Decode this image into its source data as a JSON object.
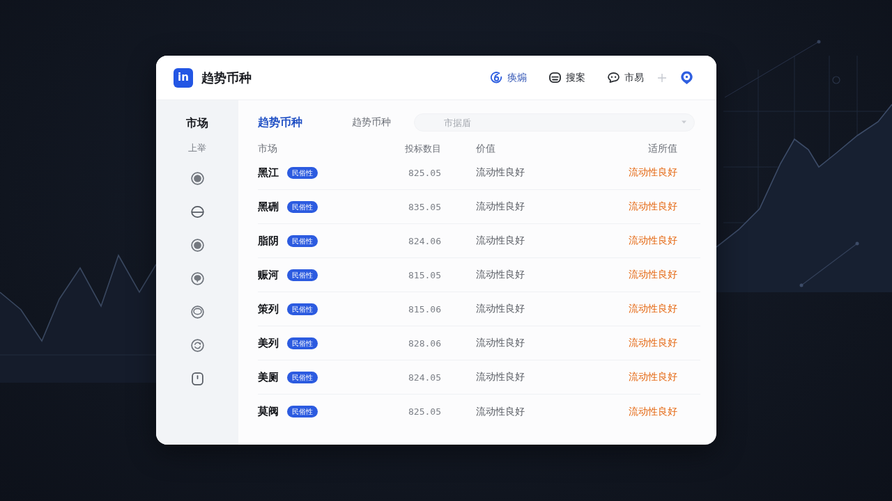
{
  "header": {
    "logo_text": "in",
    "title": "趋势币种",
    "nav": [
      {
        "label": "痪煽",
        "selected": true
      },
      {
        "label": "搜案",
        "selected": false
      },
      {
        "label": "市易",
        "selected": false
      }
    ]
  },
  "sidebar": {
    "items": [
      {
        "label": "市场",
        "selected": true
      },
      {
        "label": "上举",
        "selected": false
      }
    ]
  },
  "tabs": [
    {
      "label": "趋势币种",
      "selected": true
    },
    {
      "label": "趋势币种",
      "selected": false
    }
  ],
  "search": {
    "placeholder": "市据盾"
  },
  "table": {
    "columns": [
      "市场",
      "投标数目",
      "价值",
      "适所值"
    ],
    "rows": [
      {
        "name": "黑江",
        "tag": "民俗性",
        "amount": "825.05",
        "value": "流动性良好",
        "status": "流动性良好"
      },
      {
        "name": "黑硎",
        "tag": "民俗性",
        "amount": "835.05",
        "value": "流动性良好",
        "status": "流动性良好"
      },
      {
        "name": "脂阴",
        "tag": "民俗性",
        "amount": "824.06",
        "value": "流动性良好",
        "status": "流动性良好"
      },
      {
        "name": "赈河",
        "tag": "民俗性",
        "amount": "815.05",
        "value": "流动性良好",
        "status": "流动性良好"
      },
      {
        "name": "策列",
        "tag": "民俗性",
        "amount": "815.06",
        "value": "流动性良好",
        "status": "流动性良好"
      },
      {
        "name": "美列",
        "tag": "民俗性",
        "amount": "828.06",
        "value": "流动性良好",
        "status": "流动性良好"
      },
      {
        "name": "美厕",
        "tag": "民俗性",
        "amount": "824.05",
        "value": "流动性良好",
        "status": "流动性良好"
      },
      {
        "name": "莫阀",
        "tag": "民俗性",
        "amount": "825.05",
        "value": "流动性良好",
        "status": "流动性良好"
      }
    ]
  }
}
